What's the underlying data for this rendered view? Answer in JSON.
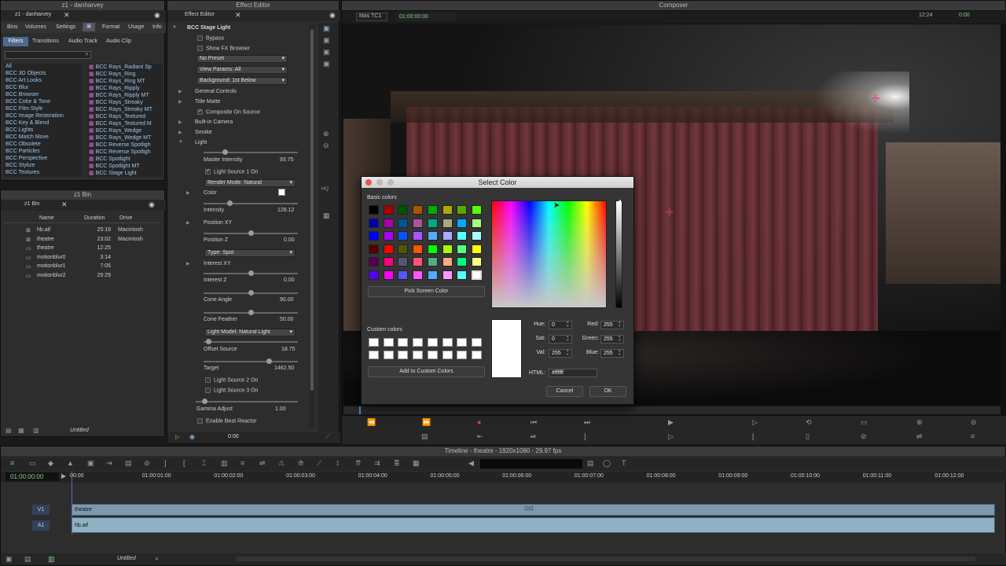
{
  "project_window": {
    "title": "z1 - danharvey",
    "inner_title": "z1 - danharvey",
    "tabs": [
      "Bins",
      "Volumes",
      "Settings",
      "Format",
      "Usage",
      "Info"
    ],
    "subtabs": [
      "Filters",
      "Transitions",
      "Audio Track",
      "Audio Clip"
    ],
    "categories": [
      "All",
      "BCC 3D Objects",
      "BCC Art Looks",
      "BCC Blur",
      "BCC Browser",
      "BCC Color & Tone",
      "BCC Film Style",
      "BCC Image Restoration",
      "BCC Key & Blend",
      "BCC Lights",
      "BCC Match Move",
      "BCC Obsolete",
      "BCC Particles",
      "BCC Perspective",
      "BCC Stylize",
      "BCC Textures"
    ],
    "effects": [
      "BCC Rays_Radiant Sp",
      "BCC Rays_Ring",
      "BCC Rays_Ring MT",
      "BCC Rays_Ripply",
      "BCC Rays_Ripply MT",
      "BCC Rays_Streaky",
      "BCC Rays_Streaky MT",
      "BCC Rays_Textured",
      "BCC Rays_Textured M",
      "BCC Rays_Wedge",
      "BCC Rays_Wedge MT",
      "BCC Reverse Spotligh",
      "BCC Reverse Spotligh",
      "BCC Spotlight",
      "BCC Spotlight MT",
      "BCC Stage Light"
    ]
  },
  "bin_window": {
    "title": "z1 Bin",
    "inner_title": "z1 Bin",
    "columns": [
      "Name",
      "Duration",
      "Drive"
    ],
    "rows": [
      {
        "name": "hb.aif",
        "duration": "25:19",
        "drive": "Macintosh"
      },
      {
        "name": "theatre",
        "duration": "23:02",
        "drive": "Macintosh"
      },
      {
        "name": "theatre",
        "duration": "12:25",
        "drive": ""
      },
      {
        "name": "motionblur0",
        "duration": "3:14",
        "drive": ""
      },
      {
        "name": "motionblur1",
        "duration": "7:05",
        "drive": ""
      },
      {
        "name": "motionblur2",
        "duration": "29:29",
        "drive": ""
      }
    ],
    "footer": "Untitled"
  },
  "effect_editor": {
    "title": "Effect Editor",
    "inner_title": "Effect Editor",
    "header": "BCC Stage Light",
    "bypass": "Bypass",
    "show_fx": "Show FX Browser",
    "preset": "No Preset",
    "view_params": "View Params: All",
    "background": "Background: 1st Below",
    "general": "General Controls",
    "title_matte": "Title Matte",
    "composite": "Composite On Source",
    "camera": "Built-in Camera",
    "smoke": "Smoke",
    "light": "Light",
    "master_intensity": "Master Intensity",
    "master_intensity_val": "93.75",
    "light1": "Light Source 1 On",
    "render_mode": "Render Mode: Natural",
    "color": "Color",
    "intensity": "Intensity",
    "intensity_val": "128.12",
    "pos_xy": "Position XY",
    "pos_z": "Position Z",
    "pos_z_val": "0.00",
    "type": "Type: Spot",
    "interest_xy": "Interest XY",
    "interest_z": "Interest Z",
    "interest_z_val": "0.00",
    "cone_angle": "Cone Angle",
    "cone_angle_val": "90.00",
    "cone_feather": "Cone Feather",
    "cone_feather_val": "50.00",
    "light_model": "Light Model: Natural Light",
    "offset_source": "Offset Source",
    "offset_source_val": "18.75",
    "target": "Target",
    "target_val": "1462.50",
    "light2": "Light Source 2 On",
    "light3": "Light Source 3 On",
    "gamma": "Gamma Adjust",
    "gamma_val": "1.00",
    "beat": "Enable Beat Reactor",
    "time": "0:00"
  },
  "composer": {
    "title": "Composer",
    "track_label": "Mas TC1",
    "timecode": "01:00:00:00",
    "right_tc1": "12:24",
    "right_tc2": "0:00"
  },
  "color_dialog": {
    "title": "Select Color",
    "basic_colors": "Basic colors",
    "pick_screen": "Pick Screen Color",
    "custom_colors": "Custom colors",
    "add_custom": "Add to Custom Colors",
    "hue_label": "Hue:",
    "hue": "0",
    "sat_label": "Sat:",
    "sat": "0",
    "val_label": "Val:",
    "val": "255",
    "red_label": "Red:",
    "red": "255",
    "green_label": "Green:",
    "green": "255",
    "blue_label": "Blue:",
    "blue": "255",
    "html_label": "HTML:",
    "html": "#ffffff",
    "cancel": "Cancel",
    "ok": "OK",
    "swatches": [
      "#000000",
      "#aa0000",
      "#005500",
      "#aa5500",
      "#00aa00",
      "#aaaa00",
      "#55aa00",
      "#55ff00",
      "#0000aa",
      "#aa00aa",
      "#005599",
      "#aa5599",
      "#00aa7f",
      "#aaaa7f",
      "#00aaff",
      "#aaff7f",
      "#0000ff",
      "#aa00ff",
      "#0055ff",
      "#aa55ff",
      "#55aaff",
      "#aaaaff",
      "#55ffff",
      "#aaffff",
      "#550000",
      "#ff0000",
      "#555500",
      "#ff5500",
      "#00ff00",
      "#aaff00",
      "#55ff7f",
      "#ffff00",
      "#550055",
      "#ff007f",
      "#555577",
      "#ff5577",
      "#55aa7f",
      "#ffaa7f",
      "#00ff7f",
      "#ffff7f",
      "#5500ff",
      "#ff00ff",
      "#5555ff",
      "#ff55ff",
      "#55aaff",
      "#ff99ff",
      "#55ffff",
      "#ffffff"
    ]
  },
  "timeline": {
    "title": "Timeline - theatre - 1920x1080 - 29.97 fps",
    "timecode": "01:00:00:00",
    "ticks": [
      "00:00",
      "01:00:01:00",
      "01:00:02:00",
      "01:00:03:00",
      "01:00:04:00",
      "01:00:05:00",
      "01:00:06:00",
      "01:00:07:00",
      "01:00:08:00",
      "01:00:09:00",
      "01:00:10:00",
      "01:00:11:00",
      "01:00:12:00",
      "01:0"
    ],
    "v1": "V1",
    "a1": "A1",
    "v1_clip": "theatre",
    "a1_clip": "hb.aif",
    "footer": "Untitled"
  }
}
